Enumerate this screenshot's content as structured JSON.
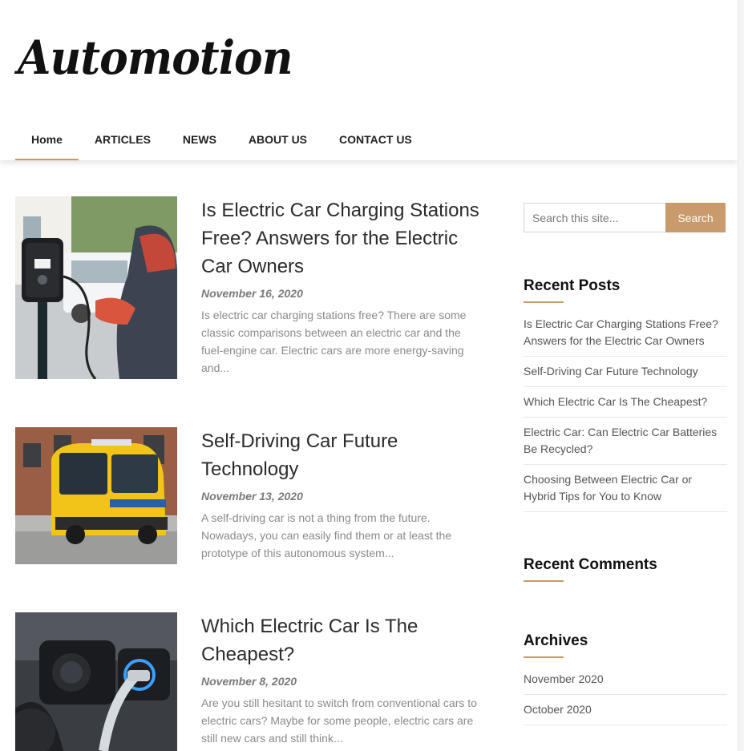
{
  "site": {
    "logo_text": "Automotion"
  },
  "nav": {
    "items": [
      {
        "label": "Home",
        "active": true
      },
      {
        "label": "ARTICLES",
        "active": false
      },
      {
        "label": "NEWS",
        "active": false
      },
      {
        "label": "ABOUT US",
        "active": false
      },
      {
        "label": "CONTACT US",
        "active": false
      }
    ]
  },
  "posts": [
    {
      "title": "Is Electric Car Charging Stations Free? Answers for the Electric Car Owners",
      "date": "November 16, 2020",
      "excerpt": "Is electric car charging stations free? There are some classic comparisons between an electric car and the fuel-engine car. Electric cars are more energy-saving and...",
      "image_icon": "ev-charging-station-image"
    },
    {
      "title": "Self-Driving Car Future Technology",
      "date": "November 13, 2020",
      "excerpt": "A self-driving car is not a thing from the future. Nowadays, you can easily find them or at least the prototype of this autonomous system...",
      "image_icon": "yellow-autonomous-shuttle-image"
    },
    {
      "title": "Which Electric Car Is The Cheapest?",
      "date": "November 8, 2020",
      "excerpt": "Are you still hesitant to switch from conventional cars to electric cars? Maybe for some people, electric cars are still new cars and still think...",
      "image_icon": "charging-plug-image"
    }
  ],
  "sidebar": {
    "search": {
      "placeholder": "Search this site...",
      "button_label": "Search"
    },
    "recent_posts": {
      "title": "Recent Posts",
      "items": [
        "Is Electric Car Charging Stations Free? Answers for the Electric Car Owners",
        "Self-Driving Car Future Technology",
        "Which Electric Car Is The Cheapest?",
        "Electric Car: Can Electric Car Batteries Be Recycled?",
        "Choosing Between Electric Car or Hybrid Tips for You to Know"
      ]
    },
    "recent_comments": {
      "title": "Recent Comments"
    },
    "archives": {
      "title": "Archives",
      "items": [
        "November 2020",
        "October 2020"
      ]
    }
  },
  "colors": {
    "accent": "#c99a6a",
    "text": "#2b2b2b",
    "muted": "#8a8a8a"
  }
}
